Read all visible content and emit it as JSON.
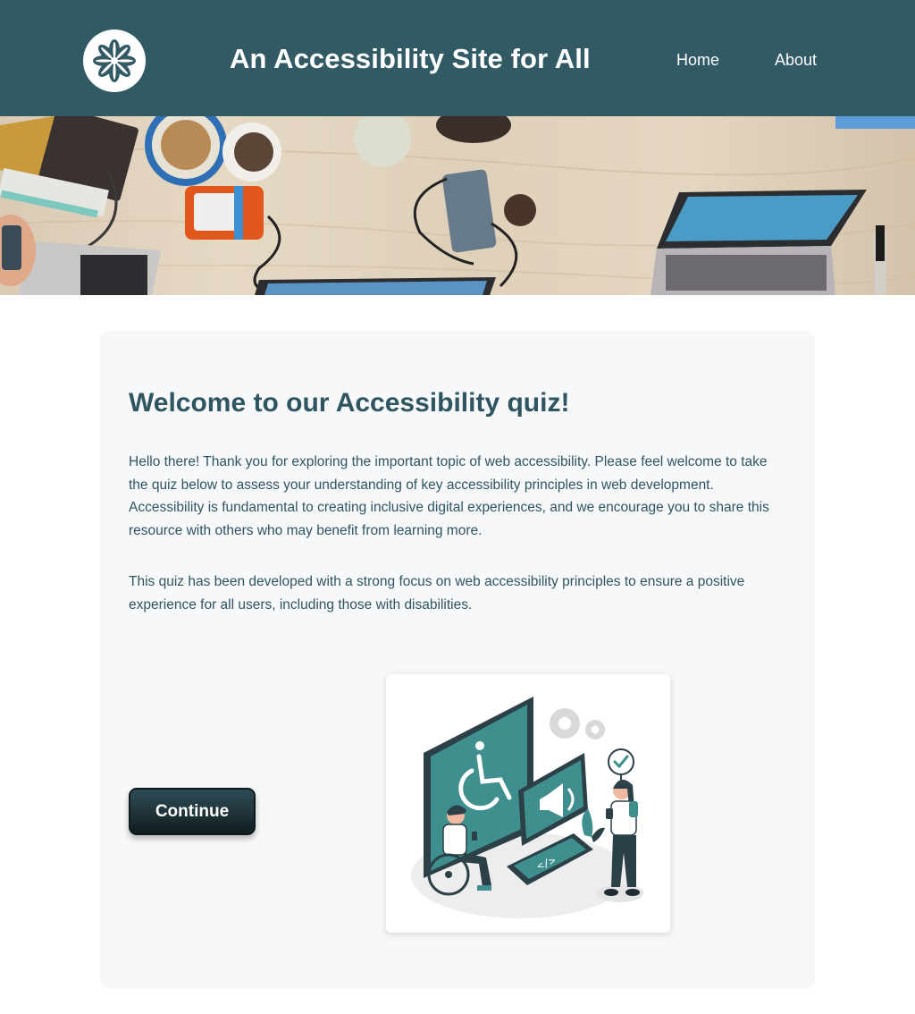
{
  "header": {
    "title": "An Accessibility Site for All",
    "logo_icon": "flower-logo-icon",
    "nav": [
      {
        "label": "Home"
      },
      {
        "label": "About"
      }
    ]
  },
  "hero": {
    "icon": "workspace-desk-photo"
  },
  "main": {
    "heading": "Welcome to our Accessibility quiz!",
    "paragraphs": [
      "Hello there! Thank you for exploring the important topic of web accessibility. Please feel welcome to take the quiz below to assess your understanding of key accessibility principles in web development. Accessibility is fundamental to creating inclusive digital experiences, and we encourage you to share this resource with others who may benefit from learning more.",
      "This quiz has been developed with a strong focus on web accessibility principles to ensure a positive experience for all users, including those with disabilities."
    ],
    "continue_label": "Continue",
    "illustration_icon": "accessibility-illustration"
  },
  "colors": {
    "header_bg": "#315a64",
    "text": "#2f5560",
    "card_bg": "#f7f8fa",
    "button_bg": "#1f3338",
    "accent_teal": "#3e8f8e"
  }
}
